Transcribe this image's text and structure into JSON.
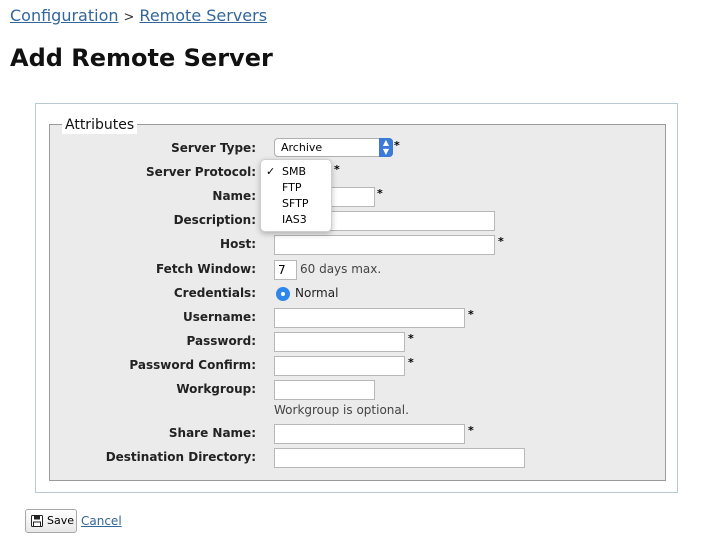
{
  "breadcrumb": {
    "item1": "Configuration",
    "separator": ">",
    "item2": "Remote Servers"
  },
  "page_title": "Add Remote Server",
  "fieldset_legend": "Attributes",
  "form": {
    "server_type": {
      "label": "Server Type:",
      "value": "Archive",
      "required": "*"
    },
    "server_protocol": {
      "label": "Server Protocol:",
      "required": "*"
    },
    "name": {
      "label": "Name:",
      "value": "",
      "required": "*"
    },
    "description": {
      "label": "Description:",
      "value": ""
    },
    "host": {
      "label": "Host:",
      "value": "",
      "required": "*"
    },
    "fetch_window": {
      "label": "Fetch Window:",
      "value": "7",
      "hint": "60 days max."
    },
    "credentials": {
      "label": "Credentials:",
      "option": "Normal"
    },
    "username": {
      "label": "Username:",
      "value": "",
      "required": "*"
    },
    "password": {
      "label": "Password:",
      "value": "",
      "required": "*"
    },
    "password_confirm": {
      "label": "Password Confirm:",
      "value": "",
      "required": "*"
    },
    "workgroup": {
      "label": "Workgroup:",
      "value": "",
      "hint": "Workgroup is optional."
    },
    "share_name": {
      "label": "Share Name:",
      "value": "",
      "required": "*"
    },
    "destination_directory": {
      "label": "Destination Directory:",
      "value": ""
    }
  },
  "protocol_menu": {
    "check": "✓",
    "options": [
      "SMB",
      "FTP",
      "SFTP",
      "IAS3"
    ],
    "selected": "SMB"
  },
  "actions": {
    "save": "Save",
    "cancel": "Cancel"
  },
  "colors": {
    "link": "#336699",
    "accent": "#2f86ea",
    "fieldset_bg": "#ebebeb"
  }
}
